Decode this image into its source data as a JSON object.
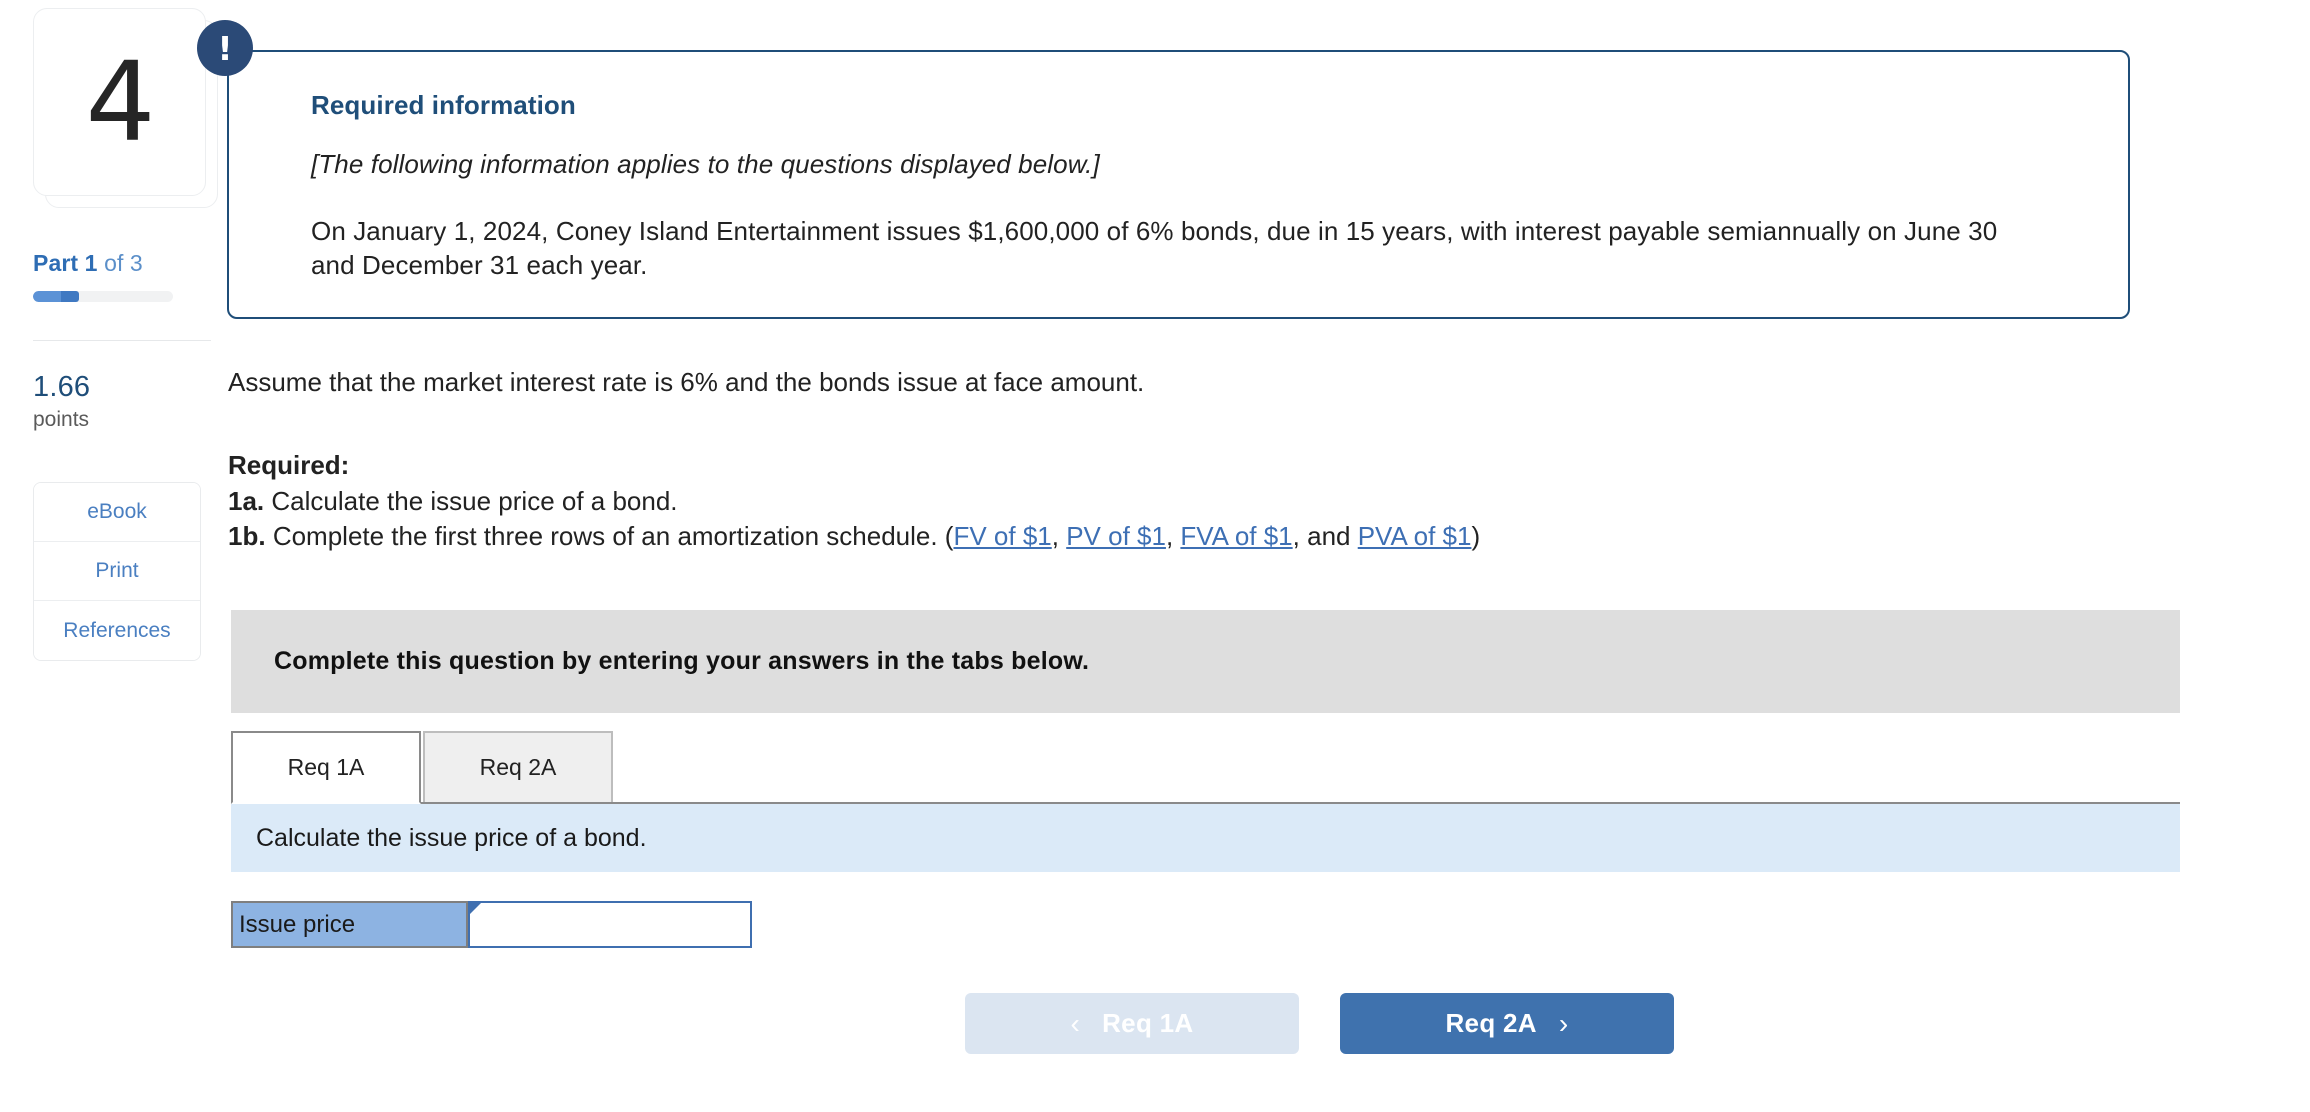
{
  "sidebar": {
    "question_number": "4",
    "part_prefix": "Part",
    "part_current": "1",
    "part_of": "of 3",
    "progress_percent": 33,
    "points_value": "1.66",
    "points_label": "points",
    "buttons": [
      {
        "label": "eBook",
        "name": "ebook"
      },
      {
        "label": "Print",
        "name": "print"
      },
      {
        "label": "References",
        "name": "references"
      }
    ]
  },
  "infobox": {
    "badge_glyph": "!",
    "title": "Required information",
    "italic_note": "[The following information applies to the questions displayed below.]",
    "body": "On January 1, 2024, Coney Island Entertainment issues $1,600,000 of 6% bonds, due in 15 years, with interest payable semiannually on June 30 and December 31 each year.",
    "border_color": "#1f4e79"
  },
  "main": {
    "assume_line": "Assume that the market interest rate is 6% and the bonds issue at face amount.",
    "required_heading": "Required:",
    "req_1a_num": "1a.",
    "req_1a_text": "Calculate the issue price of a bond.",
    "req_1b_num": "1b.",
    "req_1b_text": "Complete the first three rows of an amortization schedule. (",
    "req_1b_links": [
      "FV of $1",
      "PV of $1",
      "FVA of $1",
      "PVA of $1"
    ],
    "req_1b_sep1": ", ",
    "req_1b_sep2": ", ",
    "req_1b_sep3": ", and ",
    "req_1b_tail": ")",
    "instruction_bar": "Complete this question by entering your answers in the tabs below.",
    "tabs": [
      {
        "label": "Req 1A",
        "active": true
      },
      {
        "label": "Req 2A",
        "active": false
      }
    ],
    "tab_prompt": "Calculate the issue price of a bond.",
    "answer_label": "Issue price",
    "answer_value": "",
    "answer_placeholder": ""
  },
  "footer": {
    "prev_label": "Req 1A",
    "prev_chevron": "‹",
    "next_label": "Req 2A",
    "next_chevron": "›"
  },
  "colors": {
    "accent_blue": "#3f72ae",
    "dark_navy": "#1f4e79",
    "link_blue": "#3d6fb4",
    "gray_bar": "#dedede",
    "blue_bar": "#dbeaf8",
    "answer_label_blue": "#8db3e2"
  }
}
